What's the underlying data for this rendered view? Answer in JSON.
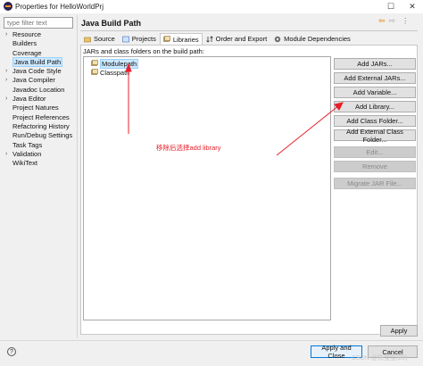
{
  "window": {
    "title": "Properties for HelloWorldPrj"
  },
  "filter": {
    "placeholder": "type filter text"
  },
  "nav": {
    "items": [
      {
        "label": "Resource",
        "caret": true
      },
      {
        "label": "Builders",
        "caret": false
      },
      {
        "label": "Coverage",
        "caret": false
      },
      {
        "label": "Java Build Path",
        "caret": false,
        "selected": true
      },
      {
        "label": "Java Code Style",
        "caret": true
      },
      {
        "label": "Java Compiler",
        "caret": true
      },
      {
        "label": "Javadoc Location",
        "caret": false
      },
      {
        "label": "Java Editor",
        "caret": true
      },
      {
        "label": "Project Natures",
        "caret": false
      },
      {
        "label": "Project References",
        "caret": false
      },
      {
        "label": "Refactoring History",
        "caret": false
      },
      {
        "label": "Run/Debug Settings",
        "caret": false
      },
      {
        "label": "Task Tags",
        "caret": false
      },
      {
        "label": "Validation",
        "caret": true
      },
      {
        "label": "WikiText",
        "caret": false
      }
    ]
  },
  "page": {
    "title": "Java Build Path"
  },
  "tabs": [
    {
      "label": "Source",
      "icon": "source-folder-icon",
      "active": false
    },
    {
      "label": "Projects",
      "icon": "projects-icon",
      "active": false
    },
    {
      "label": "Libraries",
      "icon": "libraries-icon",
      "active": true
    },
    {
      "label": "Order and Export",
      "icon": "order-export-icon",
      "active": false
    },
    {
      "label": "Module Dependencies",
      "icon": "module-dependencies-icon",
      "active": false
    }
  ],
  "libraries": {
    "label": "JARs and class folders on the build path:",
    "tree": [
      {
        "label": "Modulepath",
        "selected": true
      },
      {
        "label": "Classpath",
        "selected": false
      }
    ]
  },
  "buttons": {
    "add_jars": "Add JARs...",
    "add_external_jars": "Add External JARs...",
    "add_variable": "Add Variable...",
    "add_library": "Add Library...",
    "add_class_folder": "Add Class Folder...",
    "add_external_class_folder": "Add External Class Folder...",
    "edit": "Edit...",
    "remove": "Remove",
    "migrate_jar": "Migrate JAR File...",
    "apply": "Apply",
    "apply_and_close": "Apply and Close",
    "cancel": "Cancel"
  },
  "annotation": {
    "text": "移除后选择add library",
    "color": "#e8202a"
  },
  "watermark": {
    "text": "CSDN @陈宝宝(20)"
  },
  "colors": {
    "selection": "#cce8ff",
    "default_button_border": "#0078d7",
    "accent_orange": "#e07a00"
  }
}
